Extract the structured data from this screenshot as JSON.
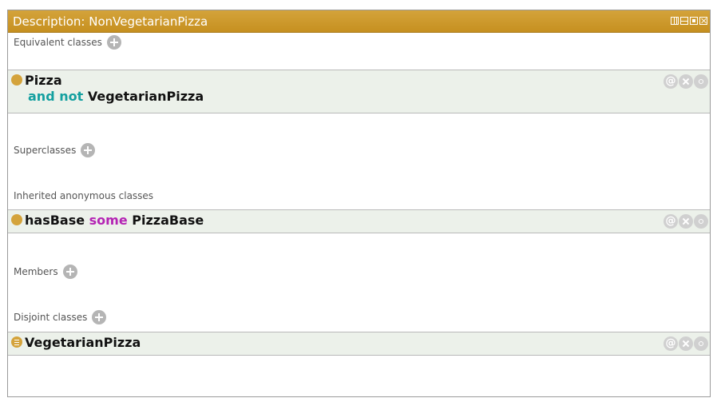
{
  "panel": {
    "title": "Description: NonVegetarianPizza",
    "controls": [
      "split-view-icon",
      "split-horizontal-icon",
      "maximize-icon",
      "close-icon"
    ]
  },
  "sections": {
    "equivalent": {
      "label": "Equivalent classes",
      "items": [
        {
          "name": "Pizza",
          "connector": "and not",
          "target": "VegetarianPizza"
        }
      ]
    },
    "superclasses": {
      "label": "Superclasses"
    },
    "inherited": {
      "label": "Inherited anonymous classes",
      "items": [
        {
          "property": "hasBase",
          "quantifier": "some",
          "filler": "PizzaBase"
        }
      ]
    },
    "members": {
      "label": "Members"
    },
    "disjoint": {
      "label": "Disjoint classes",
      "items": [
        {
          "name": "VegetarianPizza"
        }
      ]
    }
  },
  "actions": {
    "annotate": "@"
  },
  "colors": {
    "titlebar": "#c69020",
    "row_bg": "#ecf1ea",
    "keyword_teal": "#14a0a0",
    "keyword_purple": "#b424b4",
    "class_bullet": "#d4a33b"
  }
}
